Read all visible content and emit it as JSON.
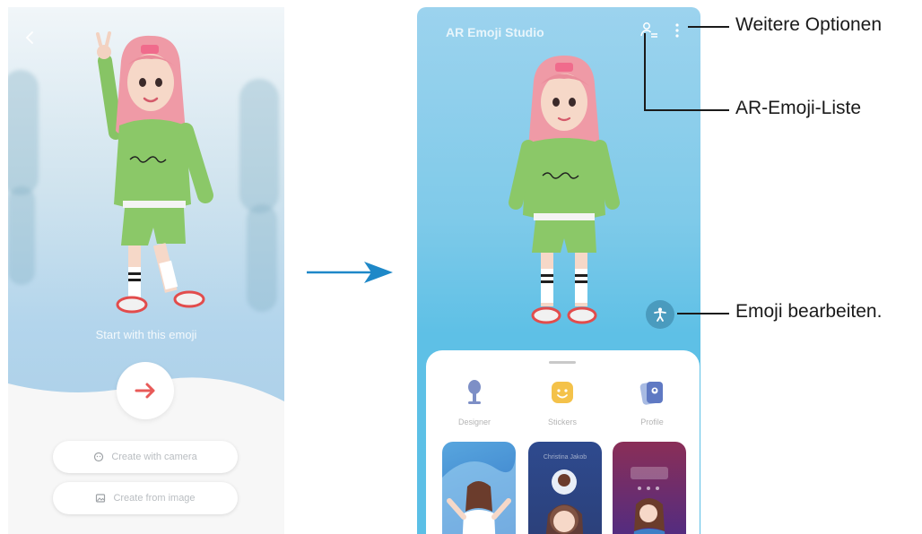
{
  "left_screen": {
    "back_icon": "chevron-left-icon",
    "start_text": "Start with this emoji",
    "next_icon": "arrow-right-icon",
    "create_with_camera": "Create with camera",
    "create_from_image": "Create from image",
    "accent_color": "#e85a58"
  },
  "right_screen": {
    "title": "AR Emoji Studio",
    "menu_items": [
      "Designer",
      "Stickers",
      "Profile"
    ],
    "preview_card_text": "Christina Jakob",
    "background_color": "#5bbfe6"
  },
  "callouts": {
    "more_options": "Weitere Optionen",
    "emoji_list": "AR-Emoji-Liste",
    "edit_emoji": "Emoji bearbeiten."
  },
  "flow_arrow_color": "#1e88c8"
}
